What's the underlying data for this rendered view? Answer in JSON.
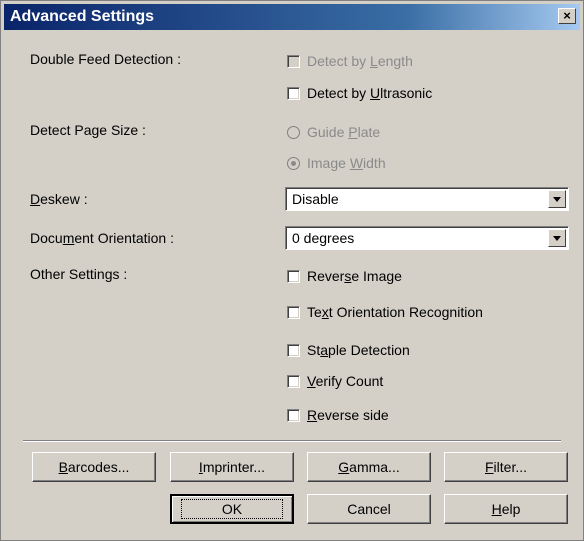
{
  "window": {
    "title": "Advanced Settings",
    "close_glyph": "×"
  },
  "double_feed": {
    "label": "Double Feed Detection :",
    "by_length": {
      "pre": "Detect by ",
      "u": "L",
      "post": "ength",
      "checked": false,
      "enabled": false
    },
    "by_ultrasonic": {
      "pre": "Detect by ",
      "u": "U",
      "post": "ltrasonic",
      "checked": false,
      "enabled": true
    }
  },
  "page_size": {
    "label": "Detect Page Size :",
    "guide_plate": {
      "pre": "Guide ",
      "u": "P",
      "post": "late",
      "selected": false,
      "enabled": false
    },
    "image_width": {
      "pre": "Image ",
      "u": "W",
      "post": "idth",
      "selected": true,
      "enabled": false
    }
  },
  "deskew": {
    "label_u": "D",
    "label_rest": "eskew :",
    "value": "Disable"
  },
  "orientation": {
    "label_pre": "Docu",
    "label_u": "m",
    "label_post": "ent Orientation :",
    "value": "0 degrees"
  },
  "other": {
    "label": "Other Settings :",
    "items": [
      {
        "pre": "Rever",
        "u": "s",
        "post": "e Image",
        "checked": false
      },
      {
        "pre": "Te",
        "u": "x",
        "post": "t Orientation Recognition",
        "checked": false
      },
      {
        "pre": "St",
        "u": "a",
        "post": "ple Detection",
        "checked": false
      },
      {
        "pre": "",
        "u": "V",
        "post": "erify Count",
        "checked": false
      },
      {
        "pre": "",
        "u": "R",
        "post": "everse side",
        "checked": false
      }
    ]
  },
  "buttons": {
    "barcodes": {
      "u": "B",
      "post": "arcodes..."
    },
    "imprinter": {
      "u": "I",
      "post": "mprinter..."
    },
    "gamma": {
      "u": "G",
      "post": "amma..."
    },
    "filter": {
      "u": "F",
      "post": "ilter..."
    },
    "ok": "OK",
    "cancel": "Cancel",
    "help": {
      "u": "H",
      "post": "elp"
    }
  }
}
